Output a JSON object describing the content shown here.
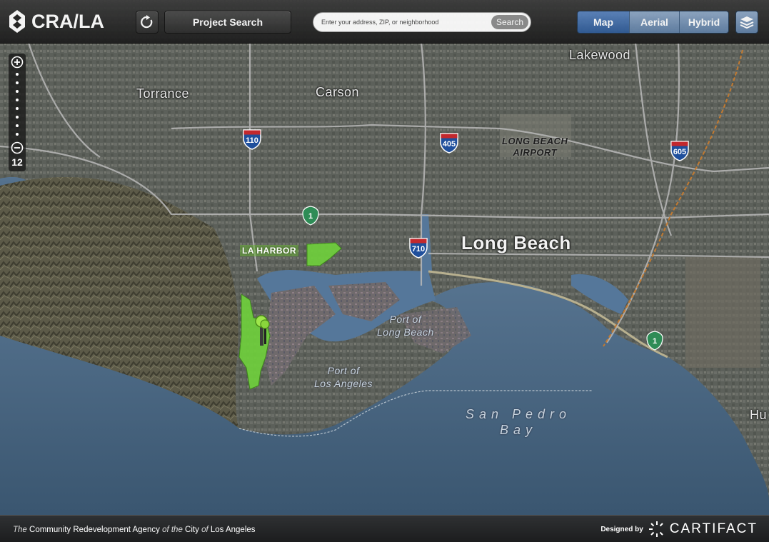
{
  "header": {
    "logo_text": "CRA/LA",
    "project_search_label": "Project Search",
    "search": {
      "placeholder": "Enter your address, ZIP, or neighborhood",
      "value": "",
      "button_label": "Search"
    },
    "map_types": [
      {
        "label": "Map",
        "active": true
      },
      {
        "label": "Aerial",
        "active": false
      },
      {
        "label": "Hybrid",
        "active": false
      }
    ]
  },
  "zoom": {
    "level": "12"
  },
  "map": {
    "places": {
      "torrance": "Torrance",
      "carson": "Carson",
      "lakewood": "Lakewood",
      "long_beach": "Long Beach",
      "airport_1": "LONG BEACH",
      "airport_2": "AIRPORT",
      "port_lb_1": "Port of",
      "port_lb_2": "Long Beach",
      "port_la_1": "Port of",
      "port_la_2": "Los Angeles",
      "bay_1": "San Pedro",
      "bay_2": "Bay",
      "hu": "Hu",
      "project_area": "LA HARBOR"
    },
    "interstates": {
      "i110": "110",
      "i405": "405",
      "i605": "605",
      "i710": "710"
    },
    "state_routes": {
      "sr1_a": "1",
      "sr1_b": "1"
    }
  },
  "footer": {
    "agency_the": "The",
    "agency_name": "Community Redevelopment Agency",
    "agency_of": "of the",
    "agency_city": "City",
    "agency_of2": "of",
    "agency_la": "Los Angeles",
    "designed_by": "Designed by",
    "designer": "CARTIFACT"
  },
  "colors": {
    "project_area": "#6fcf3c",
    "header_active": "#2e5a96",
    "water": "#4a6a86"
  }
}
